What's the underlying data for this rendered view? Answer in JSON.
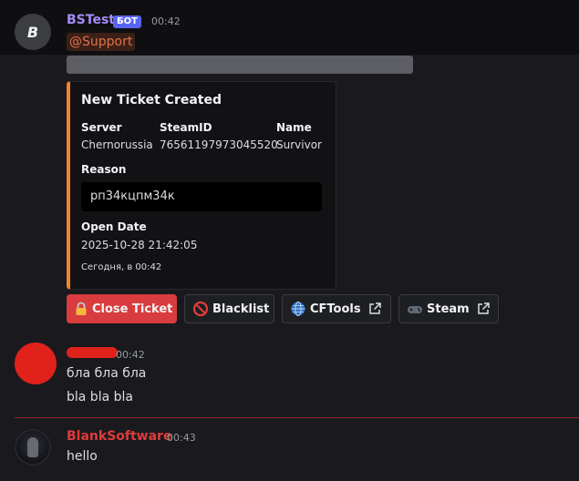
{
  "bot_message": {
    "author": "BSTest",
    "badge": "БОТ",
    "time": "00:42",
    "avatar_letter": "B",
    "mention": "@Support",
    "embed": {
      "title": "New Ticket Created",
      "fields": [
        {
          "name": "Server",
          "value": "Chernorussia"
        },
        {
          "name": "SteamID",
          "value": "76561197973045520"
        },
        {
          "name": "Name",
          "value": "Survivor"
        }
      ],
      "reason_label": "Reason",
      "reason_value": "рп34кцпм34к",
      "open_date_label": "Open Date",
      "open_date_value": "2025-10-28 21:42:05",
      "footer": "Сегодня, в 00:42"
    },
    "buttons": {
      "close_ticket": "Close Ticket",
      "blacklist": "Blacklist",
      "cftools": "CFTools",
      "steam": "Steam"
    }
  },
  "user_message": {
    "time": "00:42",
    "lines": [
      "бла бла бла",
      "bla bla bla"
    ]
  },
  "blank_message": {
    "author": "BlankSoftware",
    "time": "00:43",
    "text": "hello"
  },
  "colors": {
    "accent_orange": "#f0832c",
    "bot_name": "#a78bfa",
    "blank_name": "#e03b3b",
    "danger_button": "#d83c3e"
  }
}
